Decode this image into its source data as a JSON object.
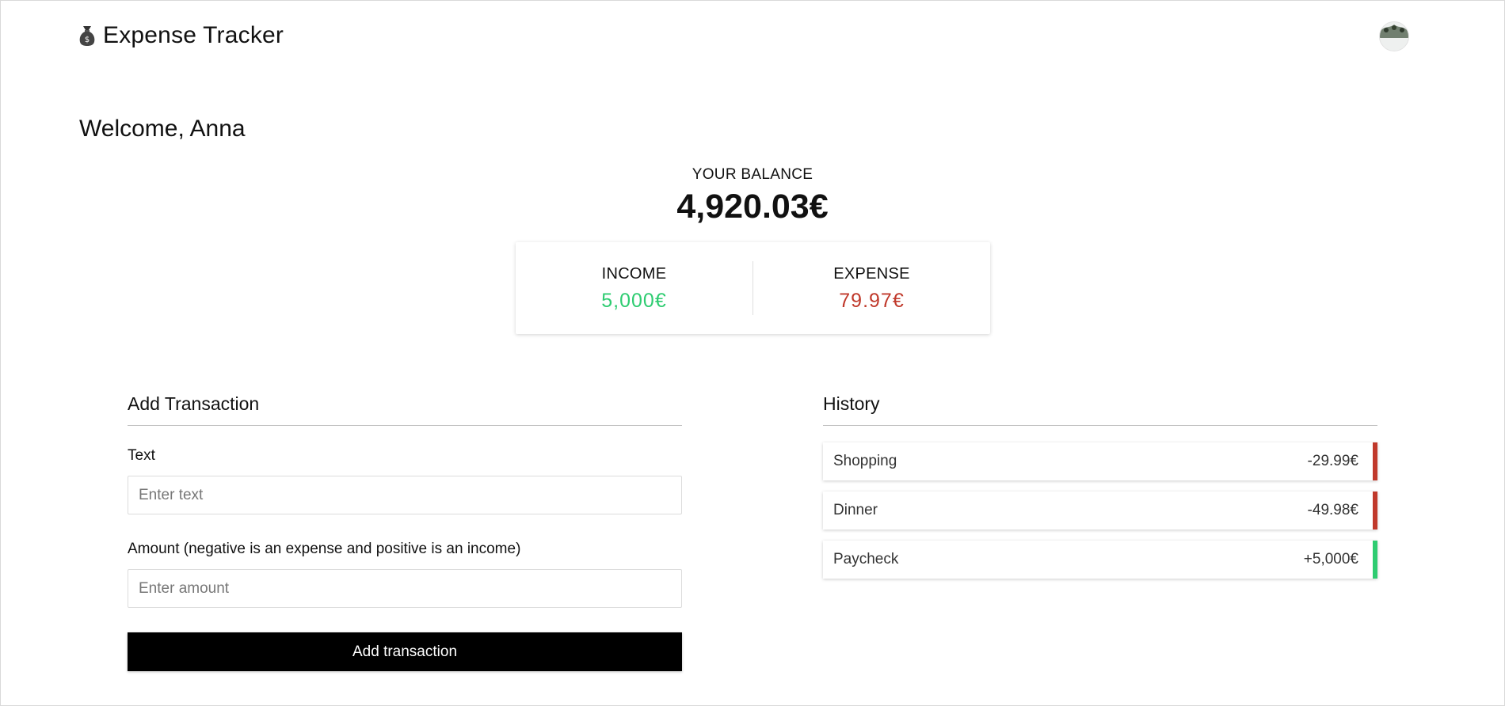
{
  "header": {
    "title": "Expense Tracker",
    "brand_icon": "money-bag-icon",
    "avatar_icon": "user-avatar"
  },
  "welcome": "Welcome, Anna",
  "balance": {
    "label": "YOUR BALANCE",
    "amount": "4,920.03€"
  },
  "summary": {
    "income_label": "INCOME",
    "income_value": "5,000€",
    "expense_label": "EXPENSE",
    "expense_value": "79.97€",
    "income_color": "#2ecc71",
    "expense_color": "#c0392b"
  },
  "form": {
    "title": "Add Transaction",
    "text_label": "Text",
    "text_placeholder": "Enter text",
    "amount_label": "Amount (negative is an expense and positive is an income)",
    "amount_placeholder": "Enter amount",
    "submit_label": "Add transaction"
  },
  "history": {
    "title": "History",
    "items": [
      {
        "name": "Shopping",
        "amount": "-29.99€",
        "type": "expense"
      },
      {
        "name": "Dinner",
        "amount": "-49.98€",
        "type": "expense"
      },
      {
        "name": "Paycheck",
        "amount": "+5,000€",
        "type": "income"
      }
    ]
  }
}
